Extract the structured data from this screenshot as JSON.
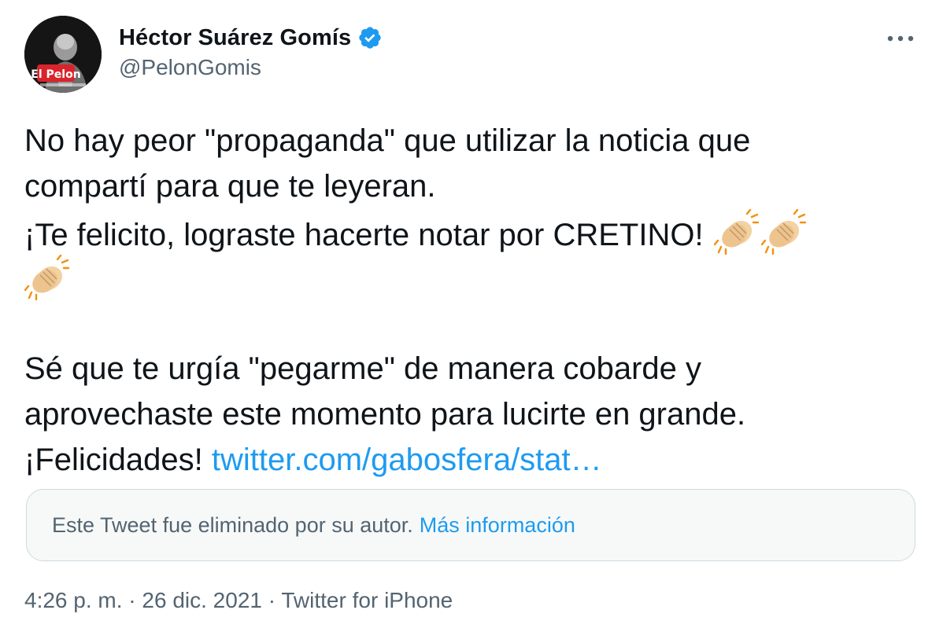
{
  "author": {
    "display_name": "Héctor Suárez Gomís",
    "handle": "@PelonGomis",
    "verified": true,
    "avatar_text": "El Pelon"
  },
  "menu": {
    "icon": "more-horizontal-icon"
  },
  "tweet": {
    "lines": [
      "No hay peor \"propaganda\" que utilizar la noticia que",
      "compartí para que te leyeran.",
      "¡Te felicito, lograste hacerte notar por CRETINO!",
      "",
      "Sé que te urgía \"pegarme\" de manera cobarde y",
      "aprovechaste este momento para lucirte en grande.",
      "¡Felicidades!"
    ],
    "link_text": "twitter.com/gabosfera/stat…",
    "emoji": "clapping-hands-icon"
  },
  "quoted_tweet": {
    "text": "Este Tweet fue eliminado por su autor.",
    "more_info": "Más información"
  },
  "meta": {
    "time": "4:26 p. m.",
    "separator": "·",
    "date": "26 dic. 2021",
    "source": "Twitter for iPhone"
  },
  "colors": {
    "link": "#1d9bf0",
    "secondary_text": "#536471",
    "primary_text": "#0f1419",
    "verified": "#1d9bf0"
  }
}
